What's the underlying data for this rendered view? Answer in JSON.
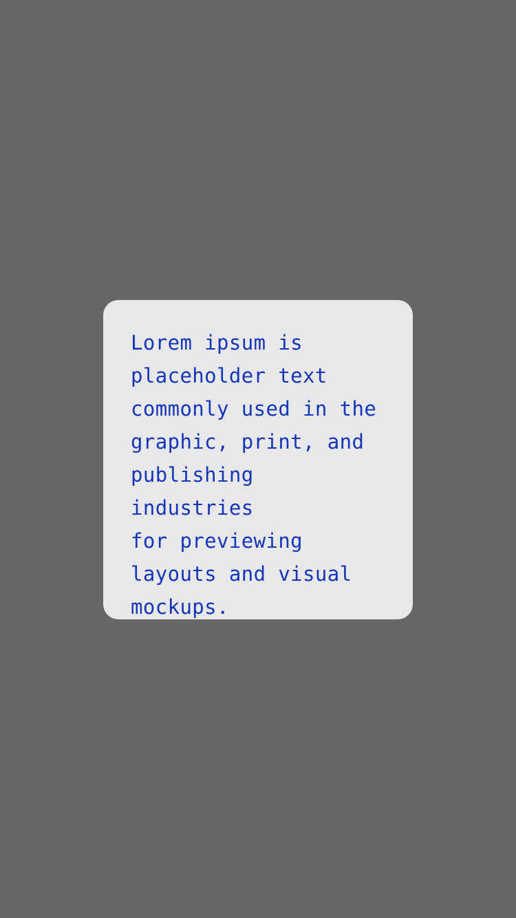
{
  "card": {
    "text": "Lorem ipsum is\nplaceholder text\ncommonly used in the\ngraphic, print, and\npublishing industries\nfor previewing\nlayouts and visual\nmockups."
  },
  "colors": {
    "background": "#676767",
    "card": "#e8e8eb",
    "text": "#1436b6"
  }
}
